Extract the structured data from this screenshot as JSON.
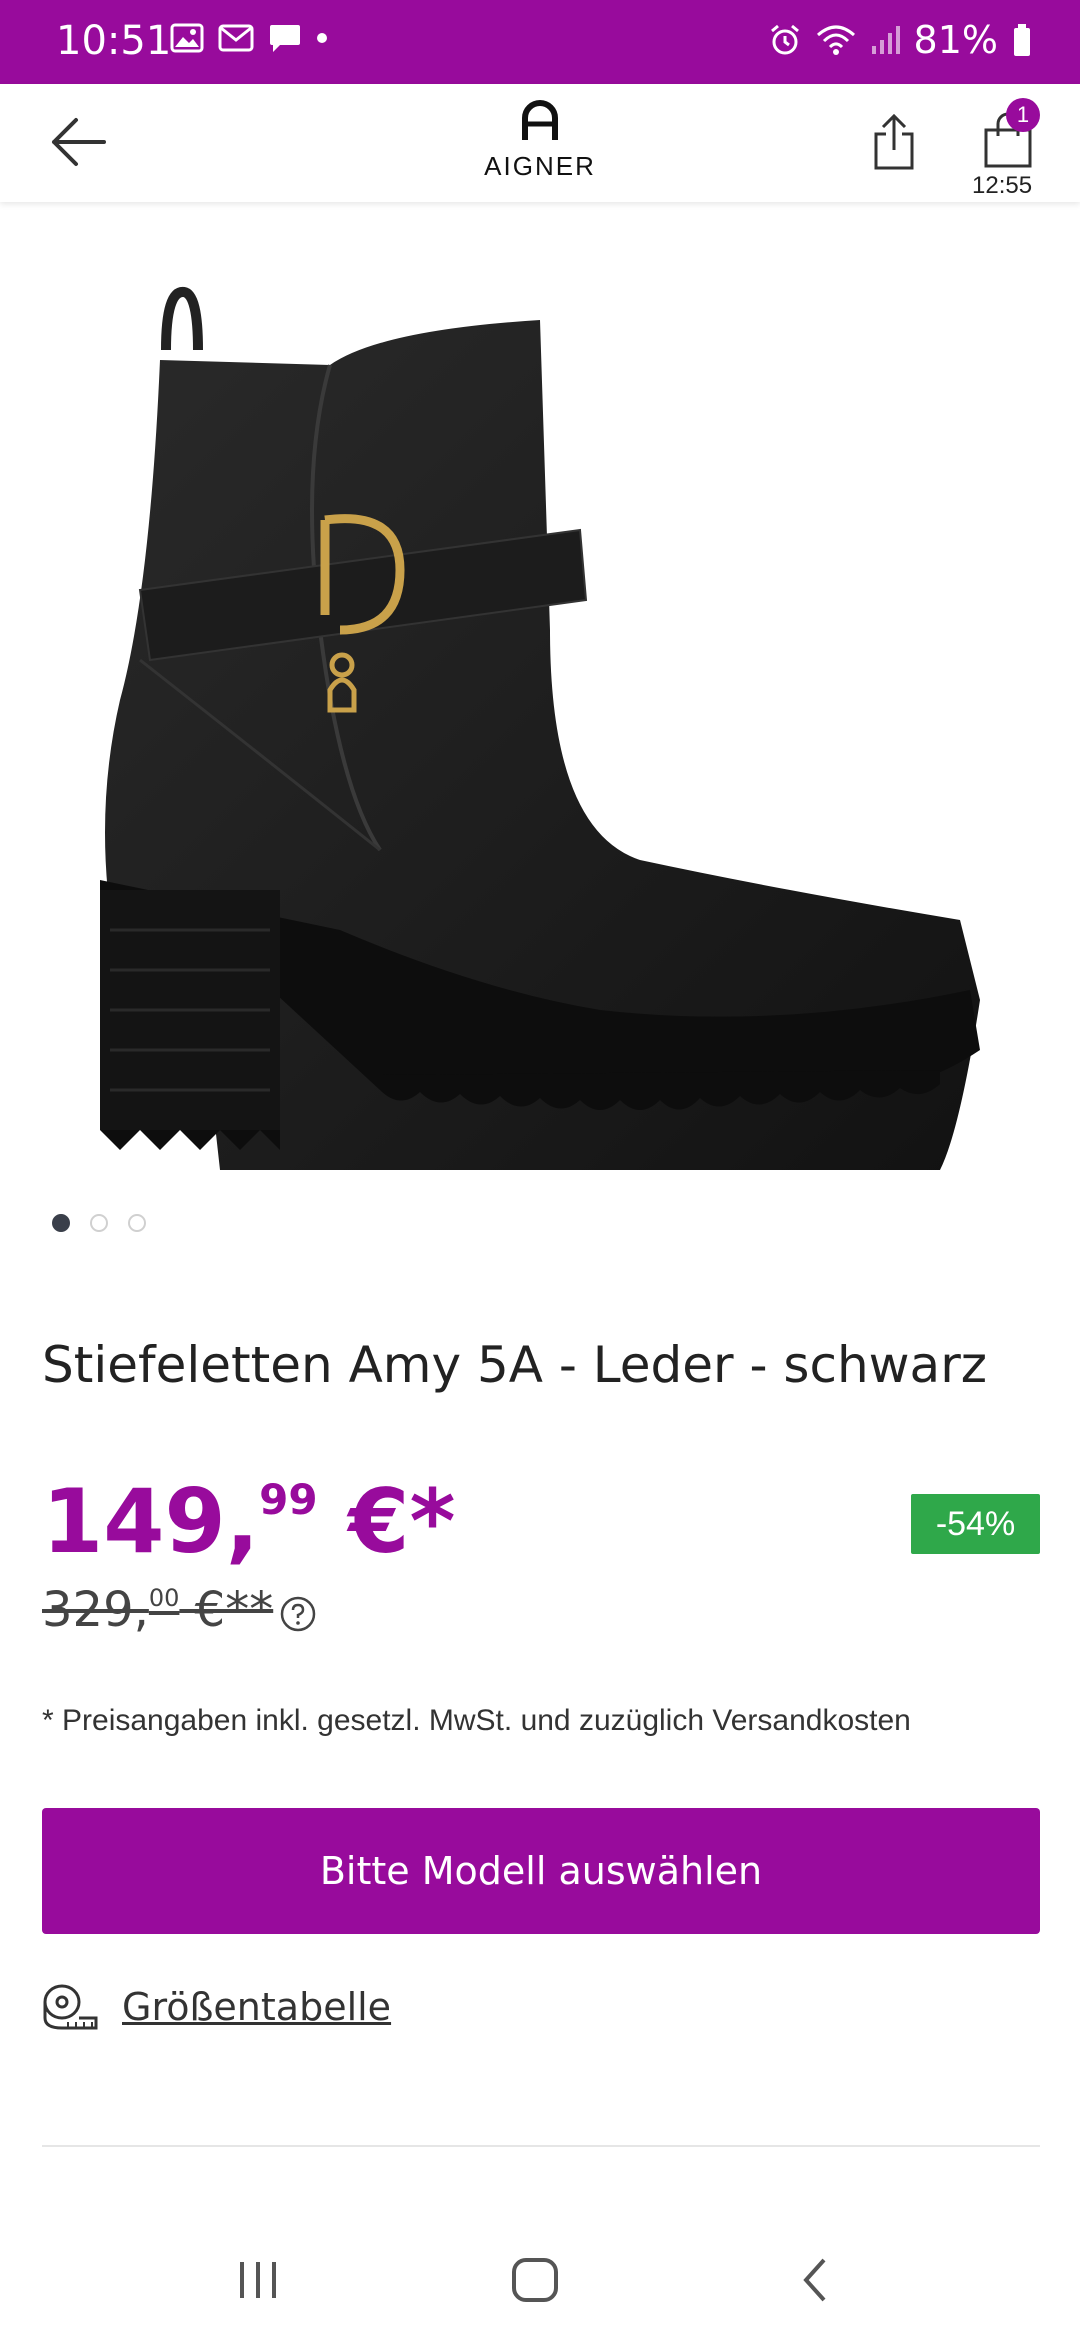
{
  "status_bar": {
    "time": "10:51",
    "battery": "81%",
    "bg_color": "#980b9c"
  },
  "header": {
    "logo_text": "AIGNER",
    "cart_count": "1",
    "cart_time": "12:55"
  },
  "product": {
    "title": "Stiefeletten Amy 5A - Leder - schwarz",
    "price_main": "149,",
    "price_cents": "99",
    "price_suffix": " €*",
    "old_price_main": "329,",
    "old_price_cents": "00",
    "old_price_suffix": " €**",
    "discount": "-54%",
    "price_note": "* Preisangaben inkl. gesetzl. MwSt. und zuzüglich Versandkosten",
    "cta_label": "Bitte Modell auswählen",
    "size_chart_label": "Größentabelle",
    "carousel_active_index": 0,
    "carousel_total": 3
  },
  "colors": {
    "accent": "#980b9c",
    "discount": "#2fa84a"
  }
}
